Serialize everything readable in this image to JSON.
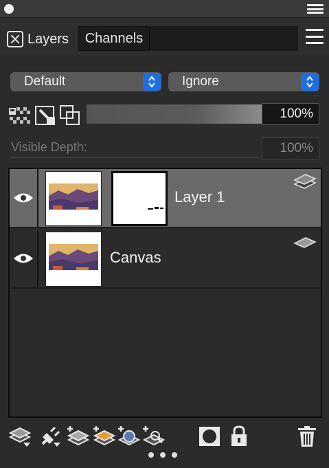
{
  "window": {
    "menu_icon": "hamburger-icon"
  },
  "tabs": [
    {
      "label": "Layers",
      "active": true,
      "close_icon": "close-box-icon"
    },
    {
      "label": "Channels",
      "active": false
    }
  ],
  "panel_menu_icon": "hamburger-icon",
  "blend_mode": {
    "value": "Default",
    "icon": "updown-stepper-icon"
  },
  "secondary_mode": {
    "value": "Ignore",
    "icon": "updown-stepper-icon"
  },
  "lock_controls": {
    "icons": [
      "lock-transparency-icon",
      "lock-paint-icon",
      "lock-move-icon"
    ],
    "opacity": "100%"
  },
  "visible_depth": {
    "label": "Visible Depth:",
    "value": "100%"
  },
  "layers": [
    {
      "name": "Layer 1",
      "selected": true,
      "visible": true,
      "has_mask": true,
      "kind_icon": "stacked-layers-icon"
    },
    {
      "name": "Canvas",
      "selected": false,
      "visible": true,
      "has_mask": false,
      "kind_icon": "canvas-layer-icon"
    }
  ],
  "footer_icons": [
    "layer-options-icon",
    "plugin-icon",
    "new-layer-icon",
    "new-paint-layer-icon",
    "new-dynamic-layer-icon",
    "new-tracing-layer-icon",
    "mask-icon",
    "lock-icon",
    "trash-icon"
  ],
  "colors": {
    "accent": "#1d6fe0",
    "selected_row": "#6a6a6a",
    "panel_bg": "#2b2b2b"
  }
}
